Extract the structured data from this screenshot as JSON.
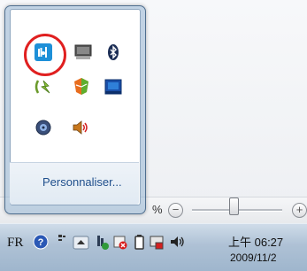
{
  "popup": {
    "customize_label": "Personnaliser...",
    "icons": [
      {
        "name": "network-adapter-icon"
      },
      {
        "name": "display-icon"
      },
      {
        "name": "bluetooth-icon"
      },
      {
        "name": "power-settings-icon"
      },
      {
        "name": "security-center-icon"
      },
      {
        "name": "book-manual-icon"
      },
      {
        "name": "media-disc-icon"
      },
      {
        "name": "speaker-icon"
      }
    ]
  },
  "zoom": {
    "percent_label": "%",
    "minus_label": "−",
    "plus_label": "+"
  },
  "taskbar": {
    "language": "FR",
    "clock": {
      "time": "上午 06:27",
      "date": "2009/11/2"
    }
  },
  "colors": {
    "highlight_ring": "#e02020",
    "link": "#1f4f8c",
    "taskbar": "#aec1d5"
  }
}
